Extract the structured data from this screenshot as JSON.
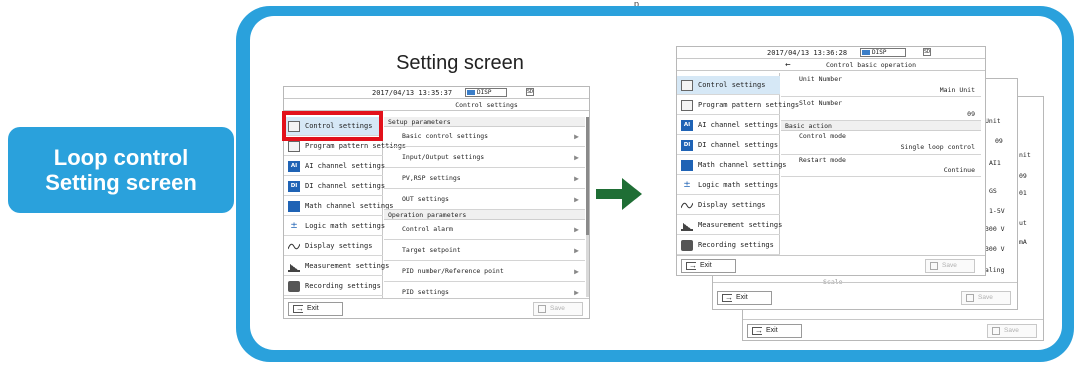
{
  "side_label": {
    "line1": "Loop control",
    "line2": "Setting screen"
  },
  "top_fragment": "p",
  "setting_title": "Setting screen",
  "screen1": {
    "datetime": "2017/04/13 13:35:37",
    "disp": "DISP",
    "sd": "SD",
    "title": "Control settings",
    "menu": [
      {
        "label": "Control settings",
        "icon": "control-settings-icon"
      },
      {
        "label": "Program pattern settings",
        "icon": "program-pattern-icon"
      },
      {
        "label": "AI channel settings",
        "icon": "ai-channel-icon",
        "badge": "AI"
      },
      {
        "label": "DI channel settings",
        "icon": "di-channel-icon",
        "badge": "DI"
      },
      {
        "label": "Math channel settings",
        "icon": "math-channel-icon"
      },
      {
        "label": "Logic math settings",
        "icon": "logic-math-icon"
      },
      {
        "label": "Display settings",
        "icon": "display-wave-icon"
      },
      {
        "label": "Measurement settings",
        "icon": "measurement-icon"
      },
      {
        "label": "Recording settings",
        "icon": "recording-icon"
      }
    ],
    "sections": [
      {
        "header": "Setup parameters",
        "items": [
          "Basic control settings",
          "Input/Output settings",
          "PV,RSP settings",
          "OUT settings"
        ]
      },
      {
        "header": "Operation parameters",
        "items": [
          "Control alarm",
          "Target setpoint",
          "PID number/Reference point",
          "PID settings"
        ]
      }
    ],
    "exit": "Exit",
    "save": "Save"
  },
  "screen2": {
    "datetime": "2017/04/13 13:36:28",
    "disp": "DISP",
    "sd": "SD",
    "back": "←",
    "title": "Control basic operation",
    "menu": [
      {
        "label": "Control settings"
      },
      {
        "label": "Program pattern settings"
      },
      {
        "label": "AI channel settings",
        "badge": "AI"
      },
      {
        "label": "DI channel settings",
        "badge": "DI"
      },
      {
        "label": "Math channel settings"
      },
      {
        "label": "Logic math settings"
      },
      {
        "label": "Display settings"
      },
      {
        "label": "Measurement settings"
      },
      {
        "label": "Recording settings"
      }
    ],
    "unit_number_label": "Unit Number",
    "unit_number_value": "Main Unit",
    "slot_number_label": "Slot Number",
    "slot_number_value": "09",
    "basic_action_header": "Basic action",
    "control_mode_label": "Control mode",
    "control_mode_value": "Single loop control",
    "restart_mode_label": "Restart mode",
    "restart_mode_value": "Continue",
    "exit": "Exit",
    "save": "Save"
  },
  "back_screen_a": {
    "peek": [
      "Unit",
      "09",
      "AI1",
      "GS",
      "1-5V",
      "300 V",
      "300 V",
      "caling"
    ],
    "exit": "Exit",
    "save": "Save",
    "frag": "Scale"
  },
  "back_screen_b": {
    "peek": [
      "nit",
      "09",
      "01",
      "ut",
      "mA"
    ],
    "exit": "Exit",
    "save": "Save"
  },
  "colors": {
    "accent": "#2aa1dc",
    "highlight": "#e2111b",
    "arrow": "#1f6e35",
    "icon_blue": "#1f63b5"
  }
}
